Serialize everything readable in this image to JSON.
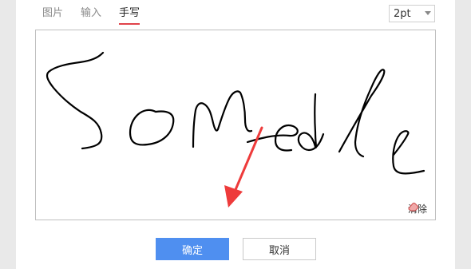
{
  "tabs": [
    {
      "label": "图片",
      "active": false
    },
    {
      "label": "输入",
      "active": false
    },
    {
      "label": "手写",
      "active": true
    }
  ],
  "pen_size": {
    "value": "2pt"
  },
  "canvas": {
    "clear_label": "清除"
  },
  "buttons": {
    "ok_label": "确定",
    "cancel_label": "取消"
  },
  "colors": {
    "accent": "#4f8ff0",
    "tab_underline": "#e0434a",
    "annotation_arrow": "#ee3b3b",
    "ink": "#000000"
  },
  "icons": {
    "clear": "eraser-icon",
    "dropdown": "chevron-down-icon"
  }
}
